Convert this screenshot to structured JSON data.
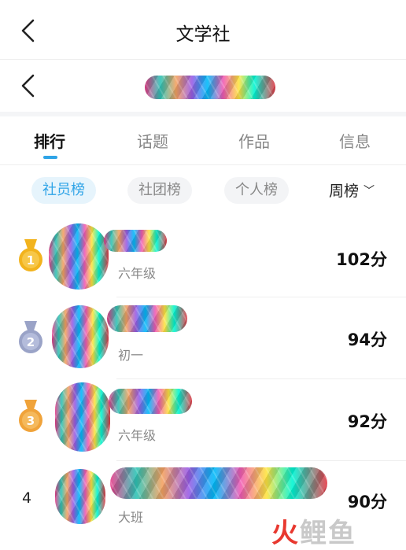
{
  "header": {
    "title": "文学社",
    "back_icon": "chevron-left-icon"
  },
  "subheader": {
    "back_icon": "chevron-left-icon"
  },
  "tabs": [
    {
      "label": "排行",
      "active": true
    },
    {
      "label": "话题",
      "active": false
    },
    {
      "label": "作品",
      "active": false
    },
    {
      "label": "信息",
      "active": false
    }
  ],
  "filters": {
    "chips": [
      {
        "label": "社员榜",
        "active": true
      },
      {
        "label": "社团榜",
        "active": false
      },
      {
        "label": "个人榜",
        "active": false
      }
    ],
    "period": "周榜",
    "period_icon": "chevron-down-icon"
  },
  "ranking": [
    {
      "rank": "1",
      "medal": "gold",
      "grade": "六年级",
      "score": "102分"
    },
    {
      "rank": "2",
      "medal": "silver",
      "grade": "初一",
      "score": "94分"
    },
    {
      "rank": "3",
      "medal": "bronze",
      "grade": "六年级",
      "score": "92分"
    },
    {
      "rank": "4",
      "medal": "none",
      "grade": "大班",
      "score": "90分"
    }
  ],
  "colors": {
    "accent": "#2fa4e7",
    "gold": "#f2b31d",
    "silver": "#9aa3c7",
    "bronze": "#f0a33a",
    "watermark_red": "#e8382f"
  },
  "watermark": {
    "part1": "火",
    "part2": "鲤鱼"
  }
}
